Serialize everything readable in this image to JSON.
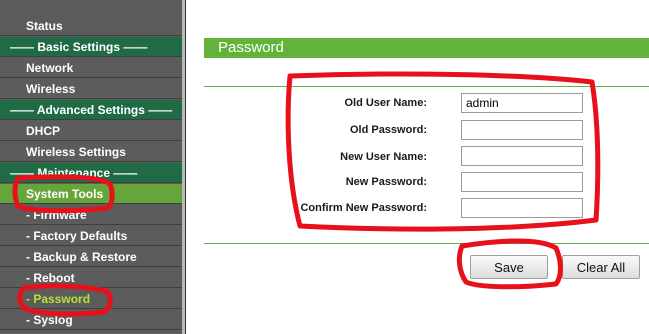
{
  "sidebar": {
    "items": [
      {
        "label": "Status",
        "type": "item"
      },
      {
        "label": "—— Basic Settings ——",
        "type": "section"
      },
      {
        "label": "Network",
        "type": "item"
      },
      {
        "label": "Wireless",
        "type": "item"
      },
      {
        "label": "—— Advanced Settings ——",
        "type": "section"
      },
      {
        "label": "DHCP",
        "type": "item"
      },
      {
        "label": "Wireless Settings",
        "type": "item"
      },
      {
        "label": "—— Maintenance ——",
        "type": "section"
      },
      {
        "label": "System Tools",
        "type": "active"
      },
      {
        "label": "- Firmware",
        "type": "sub"
      },
      {
        "label": "- Factory Defaults",
        "type": "sub"
      },
      {
        "label": "- Backup & Restore",
        "type": "sub"
      },
      {
        "label": "- Reboot",
        "type": "sub"
      },
      {
        "label": "- Password",
        "type": "current"
      },
      {
        "label": "- Syslog",
        "type": "sub"
      }
    ]
  },
  "page": {
    "title": "Password"
  },
  "form": {
    "old_user_name_label": "Old User Name:",
    "old_user_name_value": "admin",
    "old_password_label": "Old Password:",
    "old_password_value": "",
    "new_user_name_label": "New User Name:",
    "new_user_name_value": "",
    "new_password_label": "New Password:",
    "new_password_value": "",
    "confirm_password_label": "Confirm New Password:",
    "confirm_password_value": ""
  },
  "buttons": {
    "save": "Save",
    "clear_all": "Clear All"
  },
  "colors": {
    "accent_green": "#63b33a",
    "section_green": "#1e6b46",
    "sidebar_bg": "#5c5c5c",
    "annotation_red": "#e8101a",
    "current_item": "#b8e233"
  }
}
